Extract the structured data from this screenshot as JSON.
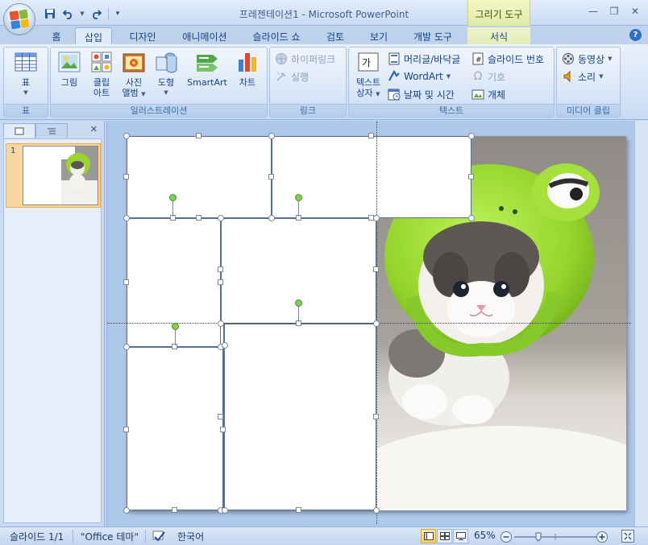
{
  "window": {
    "title": "프레젠테이션1 - Microsoft PowerPoint",
    "context_tab_title": "그리기 도구"
  },
  "qat": {
    "save": "save-icon",
    "undo": "undo-icon",
    "redo": "redo-icon"
  },
  "tabs": [
    {
      "label": "홈"
    },
    {
      "label": "삽입"
    },
    {
      "label": "디자인"
    },
    {
      "label": "애니메이션"
    },
    {
      "label": "슬라이드 쇼"
    },
    {
      "label": "검토"
    },
    {
      "label": "보기"
    },
    {
      "label": "개발 도구"
    },
    {
      "label": "서식"
    }
  ],
  "ribbon": {
    "groups": {
      "table": "표",
      "illustrations": "일러스트레이션",
      "links": "링크",
      "text": "텍스트",
      "media": "미디어 클립"
    },
    "table_btn": "표",
    "picture_btn": "그림",
    "clipart_btn1": "클립",
    "clipart_btn2": "아트",
    "photo_album_btn1": "사진",
    "photo_album_btn2": "앨범",
    "shapes_btn": "도형",
    "smartart_btn": "SmartArt",
    "chart_btn": "차트",
    "hyperlink_btn": "하이퍼링크",
    "action_btn": "실행",
    "textbox_btn1": "텍스트",
    "textbox_btn2": "상자",
    "header_footer_btn": "머리글/바닥글",
    "wordart_btn": "WordArt",
    "datetime_btn": "날짜 및 시간",
    "slide_number_btn": "슬라이드 번호",
    "symbol_btn": "기호",
    "object_btn": "개체",
    "movie_btn": "동영상",
    "sound_btn": "소리"
  },
  "status": {
    "slide": "슬라이드 1/1",
    "theme": "\"Office 테마\"",
    "language": "한국어",
    "zoom": "65%"
  },
  "thumbnail": {
    "number": "1"
  }
}
